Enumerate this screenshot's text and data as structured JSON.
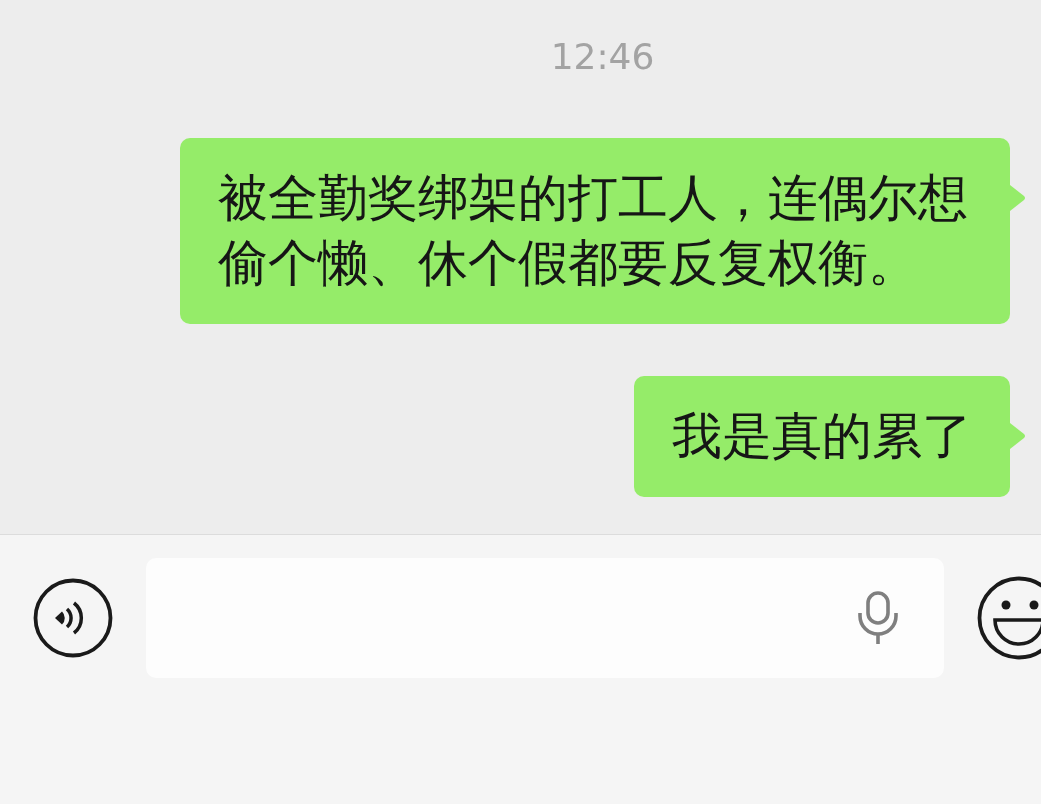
{
  "timestamp": "12:46",
  "messages": [
    {
      "text": "被全勤奖绑架的打工人，连偶尔想偷个懒、休个假都要反复权衡。",
      "outgoing": true
    },
    {
      "text": "我是真的累了",
      "outgoing": true
    }
  ]
}
